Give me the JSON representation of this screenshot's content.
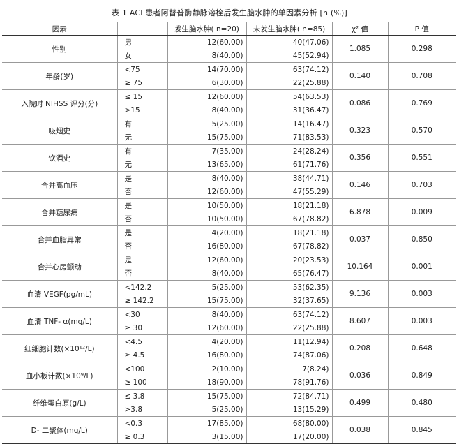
{
  "title": "表 1  ACI 患者阿替普酶静脉溶栓后发生脑水肿的单因素分析 [n (%)]",
  "header": {
    "factor": "因素",
    "edema_yes": "发生脑水肿( n=20)",
    "edema_no": "未发生脑水肿( n=85)",
    "chi2": "χ² 值",
    "p": "P 值"
  },
  "rows": [
    {
      "factor": "性别",
      "levels": [
        "男",
        "女"
      ],
      "yes": [
        "12(60.00)",
        "8(40.00)"
      ],
      "no": [
        "40(47.06)",
        "45(52.94)"
      ],
      "chi2": "1.085",
      "p": "0.298"
    },
    {
      "factor": "年龄(岁)",
      "levels": [
        "<75",
        "≥ 75"
      ],
      "yes": [
        "14(70.00)",
        "6(30.00)"
      ],
      "no": [
        "63(74.12)",
        "22(25.88)"
      ],
      "chi2": "0.140",
      "p": "0.708"
    },
    {
      "factor": "入院时 NIHSS 评分(分)",
      "levels": [
        "≤ 15",
        ">15"
      ],
      "yes": [
        "12(60.00)",
        "8(40.00)"
      ],
      "no": [
        "54(63.53)",
        "31(36.47)"
      ],
      "chi2": "0.086",
      "p": "0.769"
    },
    {
      "factor": "吸烟史",
      "levels": [
        "有",
        "无"
      ],
      "yes": [
        "5(25.00)",
        "15(75.00)"
      ],
      "no": [
        "14(16.47)",
        "71(83.53)"
      ],
      "chi2": "0.323",
      "p": "0.570"
    },
    {
      "factor": "饮酒史",
      "levels": [
        "有",
        "无"
      ],
      "yes": [
        "7(35.00)",
        "13(65.00)"
      ],
      "no": [
        "24(28.24)",
        "61(71.76)"
      ],
      "chi2": "0.356",
      "p": "0.551"
    },
    {
      "factor": "合并高血压",
      "levels": [
        "是",
        "否"
      ],
      "yes": [
        "8(40.00)",
        "12(60.00)"
      ],
      "no": [
        "38(44.71)",
        "47(55.29)"
      ],
      "chi2": "0.146",
      "p": "0.703"
    },
    {
      "factor": "合并糖尿病",
      "levels": [
        "是",
        "否"
      ],
      "yes": [
        "10(50.00)",
        "10(50.00)"
      ],
      "no": [
        "18(21.18)",
        "67(78.82)"
      ],
      "chi2": "6.878",
      "p": "0.009"
    },
    {
      "factor": "合并血脂异常",
      "levels": [
        "是",
        "否"
      ],
      "yes": [
        "4(20.00)",
        "16(80.00)"
      ],
      "no": [
        "18(21.18)",
        "67(78.82)"
      ],
      "chi2": "0.037",
      "p": "0.850"
    },
    {
      "factor": "合并心房颤动",
      "levels": [
        "是",
        "否"
      ],
      "yes": [
        "12(60.00)",
        "8(40.00)"
      ],
      "no": [
        "20(23.53)",
        "65(76.47)"
      ],
      "chi2": "10.164",
      "p": "0.001"
    },
    {
      "factor": "血清 VEGF(pg/mL)",
      "levels": [
        "<142.2",
        "≥ 142.2"
      ],
      "yes": [
        "5(25.00)",
        "15(75.00)"
      ],
      "no": [
        "53(62.35)",
        "32(37.65)"
      ],
      "chi2": "9.136",
      "p": "0.003"
    },
    {
      "factor": "血清 TNF- α(mg/L)",
      "levels": [
        "<30",
        "≥ 30"
      ],
      "yes": [
        "8(40.00)",
        "12(60.00)"
      ],
      "no": [
        "63(74.12)",
        "22(25.88)"
      ],
      "chi2": "8.607",
      "p": "0.003"
    },
    {
      "factor": "红细胞计数(×10¹²/L)",
      "levels": [
        "<4.5",
        "≥ 4.5"
      ],
      "yes": [
        "4(20.00)",
        "16(80.00)"
      ],
      "no": [
        "11(12.94)",
        "74(87.06)"
      ],
      "chi2": "0.208",
      "p": "0.648"
    },
    {
      "factor": "血小板计数(×10⁹/L)",
      "levels": [
        "<100",
        "≥ 100"
      ],
      "yes": [
        "2(10.00)",
        "18(90.00)"
      ],
      "no": [
        "7(8.24)",
        "78(91.76)"
      ],
      "chi2": "0.036",
      "p": "0.849"
    },
    {
      "factor": "纤维蛋白原(g/L)",
      "levels": [
        "≤ 3.8",
        ">3.8"
      ],
      "yes": [
        "15(75.00)",
        "5(25.00)"
      ],
      "no": [
        "72(84.71)",
        "13(15.29)"
      ],
      "chi2": "0.499",
      "p": "0.480"
    },
    {
      "factor": "D- 二聚体(mg/L)",
      "levels": [
        "<0.3",
        "≥ 0.3"
      ],
      "yes": [
        "17(85.00)",
        "3(15.00)"
      ],
      "no": [
        "68(80.00)",
        "17(20.00)"
      ],
      "chi2": "0.038",
      "p": "0.845"
    }
  ]
}
